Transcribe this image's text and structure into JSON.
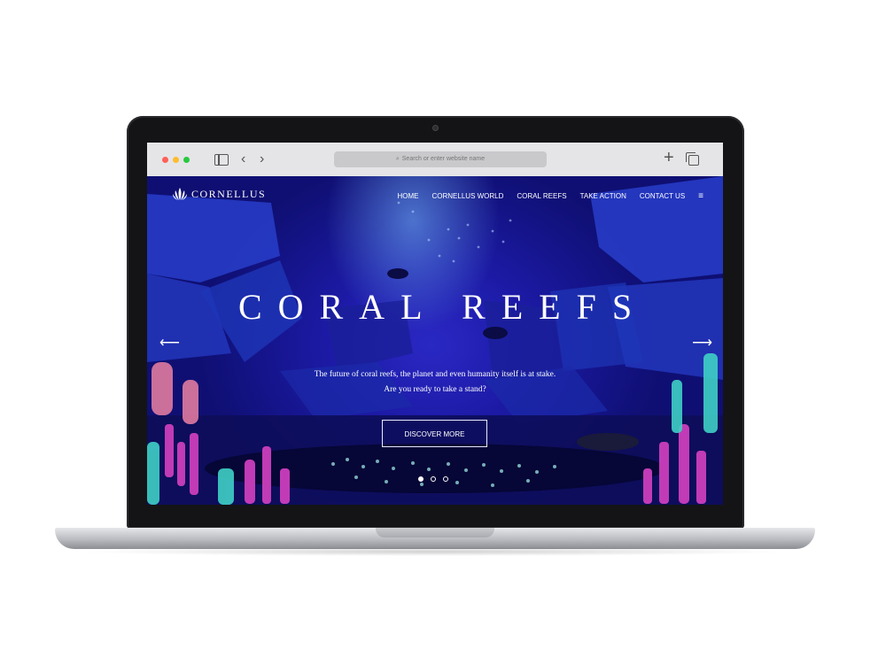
{
  "browser": {
    "address_placeholder": "Search or enter website name",
    "search_glyph": "⌕",
    "back_glyph": "‹",
    "forward_glyph": "›",
    "plus_glyph": "+"
  },
  "site": {
    "brand": "CORNELLUS",
    "nav": [
      "HOME",
      "CORNELLUS WORLD",
      "CORAL REEFS",
      "TAKE ACTION",
      "CONTACT US"
    ],
    "menu_glyph": "≡",
    "title": "CORAL REEFS",
    "subtitle_line1": "The future of coral reefs, the planet and even humanity itself is at stake.",
    "subtitle_line2": "Are you ready to take a stand?",
    "cta": "DISCOVER MORE",
    "arrow_left": "⟵",
    "arrow_right": "⟶",
    "slides_total": 3,
    "slide_active": 1
  },
  "colors": {
    "accent_ocean": "#1c1aa5",
    "deep_ocean": "#0f0f73",
    "coral_pink": "#c13bb6",
    "coral_teal": "#3fd0c6"
  },
  "icons": [
    "sidebar-icon",
    "back-icon",
    "forward-icon",
    "search-icon",
    "plus-icon",
    "tabs-icon",
    "coral-logo-icon",
    "menu-icon",
    "arrow-left-icon",
    "arrow-right-icon"
  ]
}
